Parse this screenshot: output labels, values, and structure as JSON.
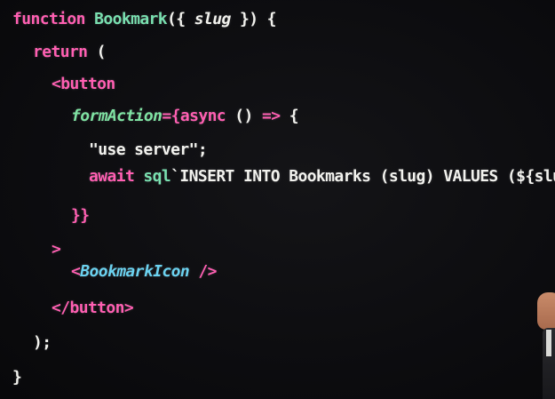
{
  "code_lines": [
    {
      "indent": 0,
      "tokens": [
        {
          "cls": "kw",
          "text": "function "
        },
        {
          "cls": "fn",
          "text": "Bookmark"
        },
        {
          "cls": "punc",
          "text": "({ "
        },
        {
          "cls": "param",
          "text": "slug"
        },
        {
          "cls": "punc",
          "text": " }) {"
        }
      ]
    },
    {
      "indent": 1,
      "tokens": [
        {
          "cls": "kw",
          "text": "return"
        },
        {
          "cls": "punc",
          "text": " ("
        }
      ]
    },
    {
      "indent": 2,
      "tokens": [
        {
          "cls": "tag",
          "text": "<button"
        }
      ]
    },
    {
      "indent": 3,
      "tokens": [
        {
          "cls": "attr",
          "text": "formAction"
        },
        {
          "cls": "kw",
          "text": "={"
        },
        {
          "cls": "kw",
          "text": "async"
        },
        {
          "cls": "punc",
          "text": " () "
        },
        {
          "cls": "kw",
          "text": "=>"
        },
        {
          "cls": "punc",
          "text": " {"
        }
      ]
    },
    {
      "indent": 4,
      "tokens": [
        {
          "cls": "str",
          "text": "\"use server\""
        },
        {
          "cls": "punc",
          "text": ";"
        }
      ]
    },
    {
      "indent": 4,
      "tokens": [
        {
          "cls": "kw",
          "text": "await "
        },
        {
          "cls": "fn",
          "text": "sql"
        },
        {
          "cls": "tmpl",
          "text": "`INSERT INTO Bookmarks (slug) VALUES (${slug});`;"
        }
      ]
    },
    {
      "indent": 3,
      "tokens": [
        {
          "cls": "kw",
          "text": "}}"
        }
      ]
    },
    {
      "indent": 2,
      "tokens": [
        {
          "cls": "tag",
          "text": ">"
        }
      ]
    },
    {
      "indent": 3,
      "tokens": [
        {
          "cls": "tag",
          "text": "<"
        },
        {
          "cls": "comp",
          "text": "BookmarkIcon"
        },
        {
          "cls": "tag",
          "text": " />"
        }
      ]
    },
    {
      "indent": 2,
      "tokens": [
        {
          "cls": "tag",
          "text": "</button>"
        }
      ]
    },
    {
      "indent": 1,
      "tokens": [
        {
          "cls": "punc",
          "text": ");"
        }
      ]
    },
    {
      "indent": 0,
      "tokens": [
        {
          "cls": "punc",
          "text": "}"
        }
      ]
    }
  ],
  "colors": {
    "keyword": "#ff5fb2",
    "function_name": "#79e0b0",
    "attribute": "#7fe3a3",
    "component": "#6bd2f0",
    "text": "#f2f2ee",
    "background": "#0b0b0d"
  }
}
